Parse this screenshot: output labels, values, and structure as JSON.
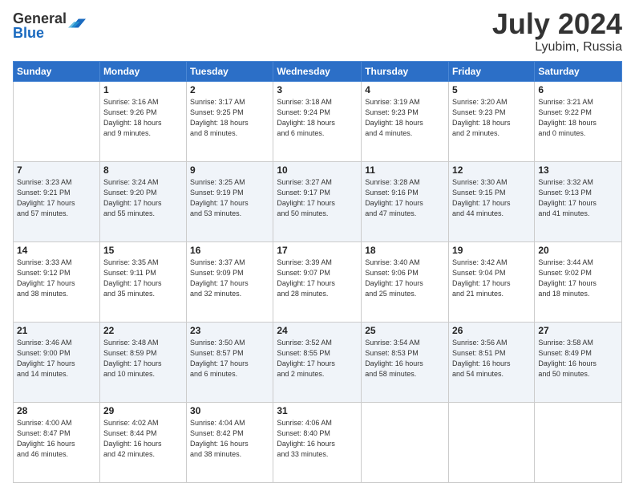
{
  "header": {
    "logo_general": "General",
    "logo_blue": "Blue",
    "month_year": "July 2024",
    "location": "Lyubim, Russia"
  },
  "weekdays": [
    "Sunday",
    "Monday",
    "Tuesday",
    "Wednesday",
    "Thursday",
    "Friday",
    "Saturday"
  ],
  "weeks": [
    [
      {
        "day": "",
        "info": ""
      },
      {
        "day": "1",
        "info": "Sunrise: 3:16 AM\nSunset: 9:26 PM\nDaylight: 18 hours\nand 9 minutes."
      },
      {
        "day": "2",
        "info": "Sunrise: 3:17 AM\nSunset: 9:25 PM\nDaylight: 18 hours\nand 8 minutes."
      },
      {
        "day": "3",
        "info": "Sunrise: 3:18 AM\nSunset: 9:24 PM\nDaylight: 18 hours\nand 6 minutes."
      },
      {
        "day": "4",
        "info": "Sunrise: 3:19 AM\nSunset: 9:23 PM\nDaylight: 18 hours\nand 4 minutes."
      },
      {
        "day": "5",
        "info": "Sunrise: 3:20 AM\nSunset: 9:23 PM\nDaylight: 18 hours\nand 2 minutes."
      },
      {
        "day": "6",
        "info": "Sunrise: 3:21 AM\nSunset: 9:22 PM\nDaylight: 18 hours\nand 0 minutes."
      }
    ],
    [
      {
        "day": "7",
        "info": "Sunrise: 3:23 AM\nSunset: 9:21 PM\nDaylight: 17 hours\nand 57 minutes."
      },
      {
        "day": "8",
        "info": "Sunrise: 3:24 AM\nSunset: 9:20 PM\nDaylight: 17 hours\nand 55 minutes."
      },
      {
        "day": "9",
        "info": "Sunrise: 3:25 AM\nSunset: 9:19 PM\nDaylight: 17 hours\nand 53 minutes."
      },
      {
        "day": "10",
        "info": "Sunrise: 3:27 AM\nSunset: 9:17 PM\nDaylight: 17 hours\nand 50 minutes."
      },
      {
        "day": "11",
        "info": "Sunrise: 3:28 AM\nSunset: 9:16 PM\nDaylight: 17 hours\nand 47 minutes."
      },
      {
        "day": "12",
        "info": "Sunrise: 3:30 AM\nSunset: 9:15 PM\nDaylight: 17 hours\nand 44 minutes."
      },
      {
        "day": "13",
        "info": "Sunrise: 3:32 AM\nSunset: 9:13 PM\nDaylight: 17 hours\nand 41 minutes."
      }
    ],
    [
      {
        "day": "14",
        "info": "Sunrise: 3:33 AM\nSunset: 9:12 PM\nDaylight: 17 hours\nand 38 minutes."
      },
      {
        "day": "15",
        "info": "Sunrise: 3:35 AM\nSunset: 9:11 PM\nDaylight: 17 hours\nand 35 minutes."
      },
      {
        "day": "16",
        "info": "Sunrise: 3:37 AM\nSunset: 9:09 PM\nDaylight: 17 hours\nand 32 minutes."
      },
      {
        "day": "17",
        "info": "Sunrise: 3:39 AM\nSunset: 9:07 PM\nDaylight: 17 hours\nand 28 minutes."
      },
      {
        "day": "18",
        "info": "Sunrise: 3:40 AM\nSunset: 9:06 PM\nDaylight: 17 hours\nand 25 minutes."
      },
      {
        "day": "19",
        "info": "Sunrise: 3:42 AM\nSunset: 9:04 PM\nDaylight: 17 hours\nand 21 minutes."
      },
      {
        "day": "20",
        "info": "Sunrise: 3:44 AM\nSunset: 9:02 PM\nDaylight: 17 hours\nand 18 minutes."
      }
    ],
    [
      {
        "day": "21",
        "info": "Sunrise: 3:46 AM\nSunset: 9:00 PM\nDaylight: 17 hours\nand 14 minutes."
      },
      {
        "day": "22",
        "info": "Sunrise: 3:48 AM\nSunset: 8:59 PM\nDaylight: 17 hours\nand 10 minutes."
      },
      {
        "day": "23",
        "info": "Sunrise: 3:50 AM\nSunset: 8:57 PM\nDaylight: 17 hours\nand 6 minutes."
      },
      {
        "day": "24",
        "info": "Sunrise: 3:52 AM\nSunset: 8:55 PM\nDaylight: 17 hours\nand 2 minutes."
      },
      {
        "day": "25",
        "info": "Sunrise: 3:54 AM\nSunset: 8:53 PM\nDaylight: 16 hours\nand 58 minutes."
      },
      {
        "day": "26",
        "info": "Sunrise: 3:56 AM\nSunset: 8:51 PM\nDaylight: 16 hours\nand 54 minutes."
      },
      {
        "day": "27",
        "info": "Sunrise: 3:58 AM\nSunset: 8:49 PM\nDaylight: 16 hours\nand 50 minutes."
      }
    ],
    [
      {
        "day": "28",
        "info": "Sunrise: 4:00 AM\nSunset: 8:47 PM\nDaylight: 16 hours\nand 46 minutes."
      },
      {
        "day": "29",
        "info": "Sunrise: 4:02 AM\nSunset: 8:44 PM\nDaylight: 16 hours\nand 42 minutes."
      },
      {
        "day": "30",
        "info": "Sunrise: 4:04 AM\nSunset: 8:42 PM\nDaylight: 16 hours\nand 38 minutes."
      },
      {
        "day": "31",
        "info": "Sunrise: 4:06 AM\nSunset: 8:40 PM\nDaylight: 16 hours\nand 33 minutes."
      },
      {
        "day": "",
        "info": ""
      },
      {
        "day": "",
        "info": ""
      },
      {
        "day": "",
        "info": ""
      }
    ]
  ]
}
